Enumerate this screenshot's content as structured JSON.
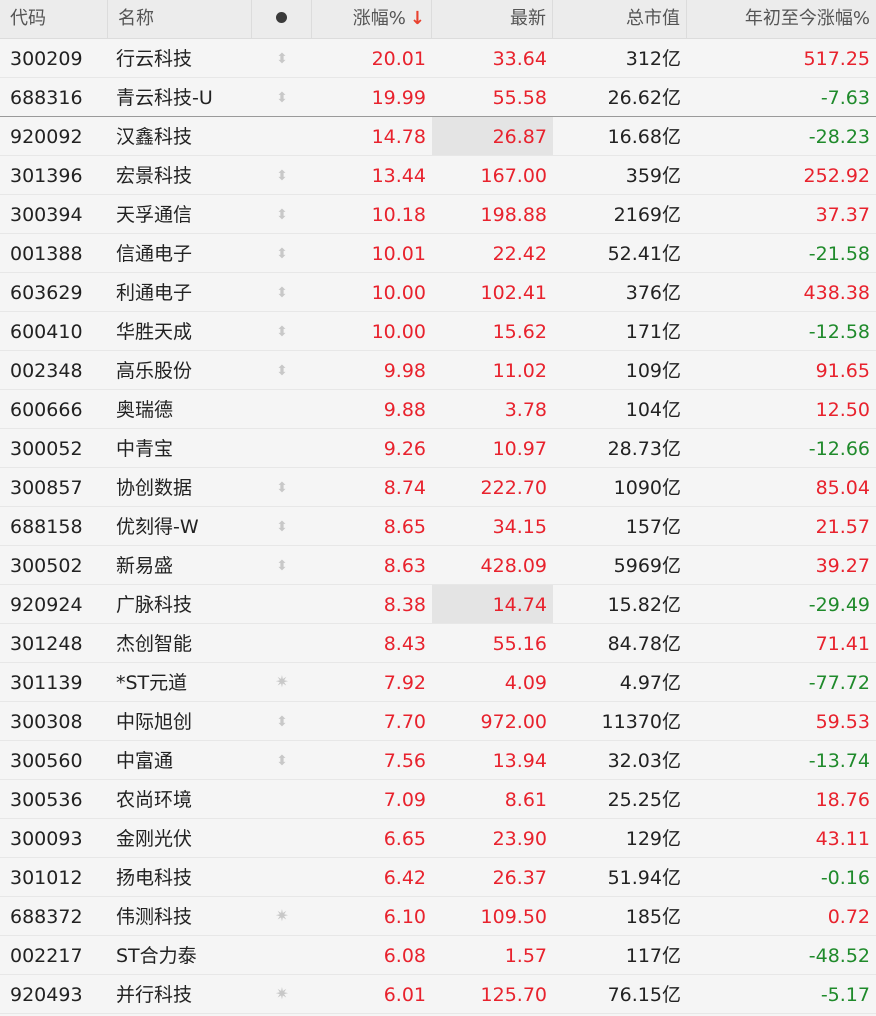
{
  "header": {
    "code": "代码",
    "name": "名称",
    "mark_icon": "dot-icon",
    "pct": "涨幅%",
    "pct_sort": "↓",
    "last": "最新",
    "cap": "总市值",
    "ytd": "年初至今涨幅%"
  },
  "colors": {
    "up": "#e8222d",
    "down": "#1f8a2b",
    "sort_arrow": "#e8422f"
  },
  "rows": [
    {
      "code": "300209",
      "name": "行云科技",
      "mark": "updown",
      "pct": "20.01",
      "last": "33.64",
      "cap": "312亿",
      "ytd": "517.25",
      "ytd_dir": "up"
    },
    {
      "code": "688316",
      "name": "青云科技-U",
      "mark": "updown",
      "pct": "19.99",
      "last": "55.58",
      "cap": "26.62亿",
      "ytd": "-7.63",
      "ytd_dir": "down"
    },
    {
      "code": "920092",
      "name": "汉鑫科技",
      "mark": "",
      "pct": "14.78",
      "last": "26.87",
      "cap": "16.68亿",
      "ytd": "-28.23",
      "ytd_dir": "down",
      "last_hl": true
    },
    {
      "code": "301396",
      "name": "宏景科技",
      "mark": "updown",
      "pct": "13.44",
      "last": "167.00",
      "cap": "359亿",
      "ytd": "252.92",
      "ytd_dir": "up"
    },
    {
      "code": "300394",
      "name": "天孚通信",
      "mark": "updown",
      "pct": "10.18",
      "last": "198.88",
      "cap": "2169亿",
      "ytd": "37.37",
      "ytd_dir": "up"
    },
    {
      "code": "001388",
      "name": "信通电子",
      "mark": "updown",
      "pct": "10.01",
      "last": "22.42",
      "cap": "52.41亿",
      "ytd": "-21.58",
      "ytd_dir": "down"
    },
    {
      "code": "603629",
      "name": "利通电子",
      "mark": "updown",
      "pct": "10.00",
      "last": "102.41",
      "cap": "376亿",
      "ytd": "438.38",
      "ytd_dir": "up"
    },
    {
      "code": "600410",
      "name": "华胜天成",
      "mark": "updown",
      "pct": "10.00",
      "last": "15.62",
      "cap": "171亿",
      "ytd": "-12.58",
      "ytd_dir": "down"
    },
    {
      "code": "002348",
      "name": "高乐股份",
      "mark": "updown",
      "pct": "9.98",
      "last": "11.02",
      "cap": "109亿",
      "ytd": "91.65",
      "ytd_dir": "up"
    },
    {
      "code": "600666",
      "name": "奥瑞德",
      "mark": "",
      "pct": "9.88",
      "last": "3.78",
      "cap": "104亿",
      "ytd": "12.50",
      "ytd_dir": "up"
    },
    {
      "code": "300052",
      "name": "中青宝",
      "mark": "",
      "pct": "9.26",
      "last": "10.97",
      "cap": "28.73亿",
      "ytd": "-12.66",
      "ytd_dir": "down"
    },
    {
      "code": "300857",
      "name": "协创数据",
      "mark": "updown",
      "pct": "8.74",
      "last": "222.70",
      "cap": "1090亿",
      "ytd": "85.04",
      "ytd_dir": "up"
    },
    {
      "code": "688158",
      "name": "优刻得-W",
      "mark": "updown",
      "pct": "8.65",
      "last": "34.15",
      "cap": "157亿",
      "ytd": "21.57",
      "ytd_dir": "up"
    },
    {
      "code": "300502",
      "name": "新易盛",
      "mark": "updown",
      "pct": "8.63",
      "last": "428.09",
      "cap": "5969亿",
      "ytd": "39.27",
      "ytd_dir": "up"
    },
    {
      "code": "920924",
      "name": "广脉科技",
      "mark": "",
      "pct": "8.38",
      "last": "14.74",
      "cap": "15.82亿",
      "ytd": "-29.49",
      "ytd_dir": "down",
      "last_hl": true
    },
    {
      "code": "301248",
      "name": "杰创智能",
      "mark": "",
      "pct": "8.43",
      "last": "55.16",
      "cap": "84.78亿",
      "ytd": "71.41",
      "ytd_dir": "up"
    },
    {
      "code": "301139",
      "name": "*ST元道",
      "mark": "star",
      "pct": "7.92",
      "last": "4.09",
      "cap": "4.97亿",
      "ytd": "-77.72",
      "ytd_dir": "down"
    },
    {
      "code": "300308",
      "name": "中际旭创",
      "mark": "updown",
      "pct": "7.70",
      "last": "972.00",
      "cap": "11370亿",
      "ytd": "59.53",
      "ytd_dir": "up"
    },
    {
      "code": "300560",
      "name": "中富通",
      "mark": "updown",
      "pct": "7.56",
      "last": "13.94",
      "cap": "32.03亿",
      "ytd": "-13.74",
      "ytd_dir": "down"
    },
    {
      "code": "300536",
      "name": "农尚环境",
      "mark": "",
      "pct": "7.09",
      "last": "8.61",
      "cap": "25.25亿",
      "ytd": "18.76",
      "ytd_dir": "up"
    },
    {
      "code": "300093",
      "name": "金刚光伏",
      "mark": "",
      "pct": "6.65",
      "last": "23.90",
      "cap": "129亿",
      "ytd": "43.11",
      "ytd_dir": "up"
    },
    {
      "code": "301012",
      "name": "扬电科技",
      "mark": "",
      "pct": "6.42",
      "last": "26.37",
      "cap": "51.94亿",
      "ytd": "-0.16",
      "ytd_dir": "down"
    },
    {
      "code": "688372",
      "name": "伟测科技",
      "mark": "star",
      "pct": "6.10",
      "last": "109.50",
      "cap": "185亿",
      "ytd": "0.72",
      "ytd_dir": "up"
    },
    {
      "code": "002217",
      "name": "ST合力泰",
      "mark": "",
      "pct": "6.08",
      "last": "1.57",
      "cap": "117亿",
      "ytd": "-48.52",
      "ytd_dir": "down"
    },
    {
      "code": "920493",
      "name": "并行科技",
      "mark": "star",
      "pct": "6.01",
      "last": "125.70",
      "cap": "76.15亿",
      "ytd": "-5.17",
      "ytd_dir": "down"
    }
  ]
}
